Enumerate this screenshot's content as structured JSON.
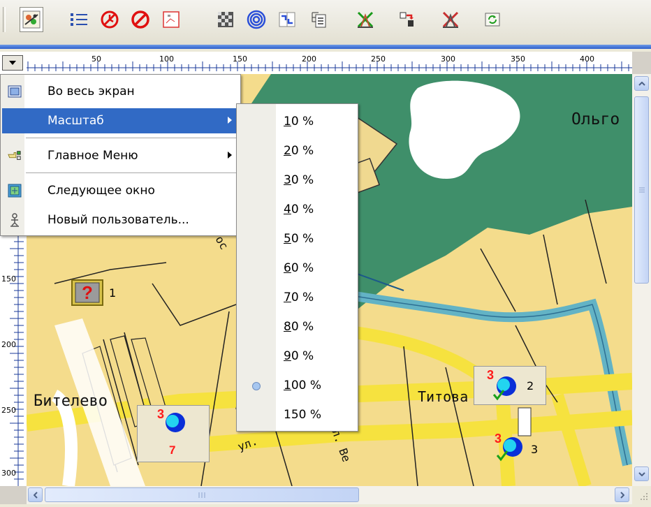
{
  "toolbar": {
    "buttons": [
      {
        "icon": "map-tool-icon",
        "pressed": true
      },
      {
        "icon": "list-icon"
      },
      {
        "icon": "stop-clock-icon"
      },
      {
        "icon": "prohibit-icon"
      },
      {
        "icon": "route-grid-icon"
      },
      {
        "icon": "checkered-icon"
      },
      {
        "icon": "concentric-circles-icon"
      },
      {
        "icon": "arrow-divider-icon"
      },
      {
        "icon": "document-tree-icon"
      },
      {
        "icon": "x-tower-green-icon"
      },
      {
        "icon": "arrow-flag-icon"
      },
      {
        "icon": "x-tower-red-icon"
      },
      {
        "icon": "refresh-icon"
      }
    ]
  },
  "ruler": {
    "top_ticks": [
      "50",
      "100",
      "150",
      "200",
      "250",
      "300",
      "350",
      "400"
    ],
    "left_ticks": [
      "150",
      "200",
      "250",
      "300"
    ]
  },
  "context_menu": {
    "items": [
      {
        "label": "Во весь экран",
        "icon": "fullscreen-icon"
      },
      {
        "label": "Масштаб",
        "submenu": true,
        "highlighted": true
      },
      {
        "label": "Главное Меню",
        "icon": "hand-pointer-icon",
        "submenu": true
      },
      {
        "label": "Следующее окно",
        "icon": "next-window-icon"
      },
      {
        "label": "Новый пользователь...",
        "icon": "new-user-icon"
      }
    ]
  },
  "zoom_menu": {
    "items": [
      {
        "label": "10 %",
        "mnemonic": "1",
        "rest": "0 %"
      },
      {
        "label": "20 %",
        "mnemonic": "2",
        "rest": "0 %"
      },
      {
        "label": "30 %",
        "mnemonic": "3",
        "rest": "0 %"
      },
      {
        "label": "40 %",
        "mnemonic": "4",
        "rest": "0 %"
      },
      {
        "label": "50 %",
        "mnemonic": "5",
        "rest": "0 %"
      },
      {
        "label": "60 %",
        "mnemonic": "6",
        "rest": "0 %"
      },
      {
        "label": "70 %",
        "mnemonic": "7",
        "rest": "0 %"
      },
      {
        "label": "80 %",
        "mnemonic": "8",
        "rest": "0 %"
      },
      {
        "label": "90 %",
        "mnemonic": "9",
        "rest": "0 %"
      },
      {
        "label": "100 %",
        "mnemonic": "1",
        "rest": "00 %",
        "selected": true
      },
      {
        "label": "150 %",
        "mnemonic": "",
        "rest": "150 %"
      }
    ]
  },
  "map": {
    "place_labels": {
      "olgo": "Ольго",
      "bitelevo": "Бителево",
      "titova": "Титова",
      "ul": "ул.",
      "street_diag": "ул. Ве",
      "partial_a": "ос"
    },
    "objects": [
      {
        "id": "1",
        "type": "unknown"
      },
      {
        "id": "2",
        "badge": "3"
      },
      {
        "id": "3",
        "badge": "3"
      },
      {
        "id": "7",
        "badge": "3"
      }
    ]
  },
  "colors": {
    "menu_highlight": "#316ac5",
    "map_water": "#63b3c5",
    "map_park": "#3f8f6a",
    "map_land": "#f4dc8c",
    "road": "#f6e23f",
    "badge_red": "#ff1a1a",
    "badge_blue": "#0a2fd8"
  }
}
